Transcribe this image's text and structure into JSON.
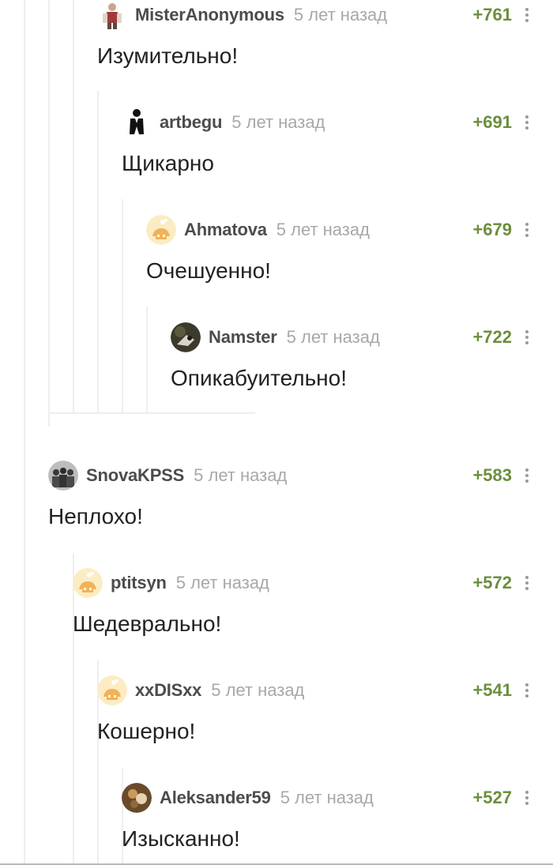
{
  "comments": [
    {
      "user": "MisterAnonymous",
      "time": "5 лет назад",
      "score": "+761",
      "text": "Изумительно!",
      "avatar": "accordion-player-avatar"
    },
    {
      "user": "artbegu",
      "time": "5 лет назад",
      "score": "+691",
      "text": "Щикарно",
      "avatar": "suit-avatar"
    },
    {
      "user": "Ahmatova",
      "time": "5 лет назад",
      "score": "+679",
      "text": "Очешуенно!",
      "avatar": "default-avatar"
    },
    {
      "user": "Namster",
      "time": "5 лет назад",
      "score": "+722",
      "text": "Опикабуительно!",
      "avatar": "creature-avatar"
    },
    {
      "user": "SnovaKPSS",
      "time": "5 лет назад",
      "score": "+583",
      "text": "Неплохо!",
      "avatar": "group-photo-avatar"
    },
    {
      "user": "ptitsyn",
      "time": "5 лет назад",
      "score": "+572",
      "text": "Шедеврально!",
      "avatar": "default-avatar"
    },
    {
      "user": "xxDISxx",
      "time": "5 лет назад",
      "score": "+541",
      "text": "Кошерно!",
      "avatar": "default-avatar"
    },
    {
      "user": "Aleksander59",
      "time": "5 лет назад",
      "score": "+527",
      "text": "Изысканно!",
      "avatar": "photo-avatar"
    }
  ],
  "colors": {
    "score": "#6b8f3b",
    "username": "#4c4c4c",
    "time": "#a8a8a8",
    "text": "#222222",
    "thread_line": "#eeeeee"
  }
}
